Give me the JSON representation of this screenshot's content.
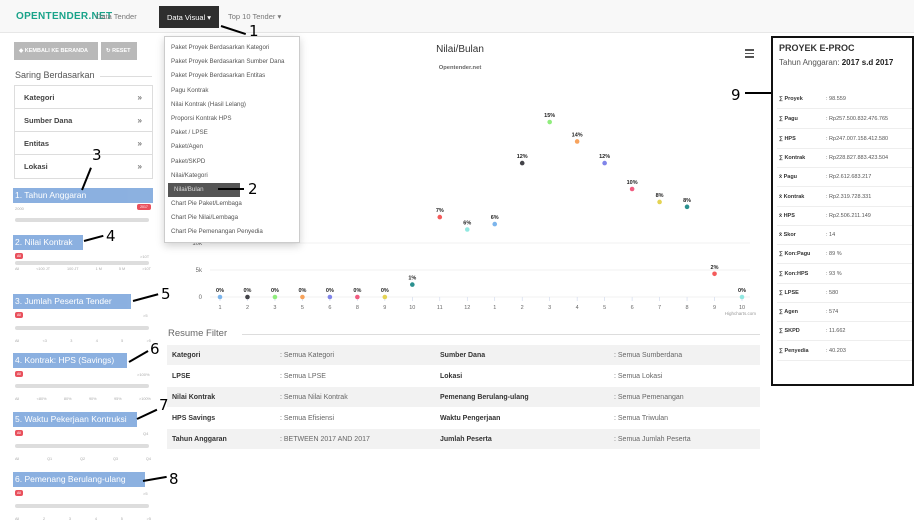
{
  "navbar": {
    "brand": "OPENTENDER.NET",
    "items": [
      "Data Tender",
      "Data Visual ▾",
      "Top 10 Tender ▾"
    ]
  },
  "dropdown": {
    "items": [
      "Paket Proyek Berdasarkan Kategori",
      "Paket Proyek Berdasarkan Sumber Dana",
      "Paket Proyek Berdasarkan Entitas",
      "Pagu Kontrak",
      "Nilai Kontrak (Hasil Lelang)",
      "Proporsi Kontrak HPS",
      "Paket / LPSE",
      "Paket/Agen",
      "Paket/SKPD",
      "Nilai/Kategori",
      "Nilai/Bulan",
      "Chart Pie Paket/Lembaga",
      "Chart Pie Nilai/Lembaga",
      "Chart Pie Pemenangan Penyedia"
    ]
  },
  "annotations": [
    "1",
    "2",
    "3",
    "4",
    "5",
    "6",
    "7",
    "8",
    "9"
  ],
  "sidebar": {
    "btn_back": "◆ KEMBALI KE BERANDA",
    "btn_reset": "↻ RESET",
    "saring_title": "Saring Berdasarkan",
    "filters": [
      "Kategori",
      "Sumber Dana",
      "Entitas",
      "Lokasi"
    ],
    "chev": "»",
    "sections": [
      {
        "label": "1. Tahun Anggaran",
        "min": "2000",
        "max": "2017",
        "ticks": []
      },
      {
        "label": "2. Nilai Kontrak",
        "min": "All",
        "max": ">10T",
        "ticks": [
          "All",
          "<100 JT",
          "100 JT",
          "1 M",
          "5 M",
          ">10T"
        ]
      },
      {
        "label": "3. Jumlah Peserta Tender",
        "min": "All",
        "max": ">5",
        "ticks": [
          "All",
          "<3",
          "3",
          "4",
          "5",
          ">5"
        ]
      },
      {
        "label": "4. Kontrak: HPS (Savings)",
        "min": "All",
        "max": ">100%",
        "ticks": [
          "All",
          "<80%",
          "80%",
          "90%",
          "95%",
          ">100%"
        ]
      },
      {
        "label": "5. Waktu Pekerjaan Kontruksi",
        "min": "All",
        "max": "Q4",
        "ticks": [
          "All",
          "Q1",
          "Q2",
          "Q3",
          "Q4"
        ]
      },
      {
        "label": "6. Pemenang Berulang-ulang",
        "min": "All",
        "max": ">5",
        "ticks": [
          "All",
          "2",
          "3",
          "4",
          "5",
          ">5"
        ]
      }
    ]
  },
  "chart_data": {
    "type": "scatter",
    "title": "Nilai/Bulan",
    "subtitle": "Opentender.net",
    "credit": "Highcharts.com",
    "y_ticks": [
      "0",
      "5k",
      "10k"
    ],
    "x_ticks": [
      "1",
      "2",
      "3",
      "5",
      "6",
      "8",
      "9",
      "10",
      "11",
      "12",
      "1",
      "2",
      "3",
      "4",
      "5",
      "6",
      "7",
      "8",
      "9",
      "10"
    ],
    "points": [
      {
        "x": 0,
        "y": 0,
        "label": "0%",
        "color": "#7cb5ec"
      },
      {
        "x": 1,
        "y": 0,
        "label": "0%",
        "color": "#434348"
      },
      {
        "x": 2,
        "y": 0,
        "label": "0%",
        "color": "#90ed7d"
      },
      {
        "x": 3,
        "y": 0,
        "label": "0%",
        "color": "#f7a35c"
      },
      {
        "x": 4,
        "y": 0,
        "label": "0%",
        "color": "#8085e9"
      },
      {
        "x": 5,
        "y": 0,
        "label": "0%",
        "color": "#f15c80"
      },
      {
        "x": 6,
        "y": 0,
        "label": "0%",
        "color": "#e4d354"
      },
      {
        "x": 7,
        "y": 2300,
        "label": "1%",
        "color": "#2b908f"
      },
      {
        "x": 8,
        "y": 14800,
        "label": "7%",
        "color": "#f45b5b"
      },
      {
        "x": 9,
        "y": 12500,
        "label": "6%",
        "color": "#91e8e1"
      },
      {
        "x": 10,
        "y": 13500,
        "label": "6%",
        "color": "#7cb5ec"
      },
      {
        "x": 11,
        "y": 24800,
        "label": "12%",
        "color": "#434348"
      },
      {
        "x": 12,
        "y": 32400,
        "label": "15%",
        "color": "#90ed7d"
      },
      {
        "x": 13,
        "y": 28800,
        "label": "14%",
        "color": "#f7a35c"
      },
      {
        "x": 14,
        "y": 24800,
        "label": "12%",
        "color": "#8085e9"
      },
      {
        "x": 15,
        "y": 20000,
        "label": "10%",
        "color": "#f15c80"
      },
      {
        "x": 16,
        "y": 17600,
        "label": "8%",
        "color": "#e4d354"
      },
      {
        "x": 17,
        "y": 16700,
        "label": "8%",
        "color": "#2b908f"
      },
      {
        "x": 18,
        "y": 4300,
        "label": "2%",
        "color": "#f45b5b"
      },
      {
        "x": 19,
        "y": 0,
        "label": "0%",
        "color": "#91e8e1"
      }
    ]
  },
  "resume": {
    "title": "Resume Filter",
    "rows": [
      [
        "Kategori",
        ": Semua Kategori",
        "Sumber Dana",
        ": Semua Sumberdana"
      ],
      [
        "LPSE",
        ": Semua LPSE",
        "Lokasi",
        ": Semua Lokasi"
      ],
      [
        "Nilai Kontrak",
        ": Semua Nilai Kontrak",
        "Pemenang Berulang-ulang",
        ": Semua Pemenangan"
      ],
      [
        "HPS Savings",
        ": Semua Efisiensi",
        "Waktu Pengerjaan",
        ": Semua Triwulan"
      ],
      [
        "Tahun Anggaran",
        ": BETWEEN 2017 AND 2017",
        "Jumlah Peserta",
        ": Semua Jumlah Peserta"
      ]
    ]
  },
  "panel": {
    "title": "PROYEK E-PROC",
    "year_label": "Tahun Anggaran:",
    "year_value": "2017 s.d 2017",
    "rows": [
      [
        "∑ Proyek",
        ": 98.559"
      ],
      [
        "∑ Pagu",
        ": Rp257.500.832.476.765"
      ],
      [
        "∑ HPS",
        ": Rp247.007.158.412.580"
      ],
      [
        "∑ Kontrak",
        ": Rp228.827.883.423.504"
      ],
      [
        "x̄ Pagu",
        ": Rp2.612.683.217"
      ],
      [
        "x̄ Kontrak",
        ": Rp2.319.728.331"
      ],
      [
        "x̄ HPS",
        ": Rp2.506.211.149"
      ],
      [
        "x̄ Skor",
        ": 14"
      ],
      [
        "∑ Kon:Pagu",
        ": 89 %"
      ],
      [
        "∑ Kon:HPS",
        ": 93 %"
      ],
      [
        "∑ LPSE",
        ": 580"
      ],
      [
        "∑ Agen",
        ": 574"
      ],
      [
        "∑ SKPD",
        ": 11.662"
      ],
      [
        "∑ Penyedia",
        ": 40.203"
      ]
    ]
  }
}
